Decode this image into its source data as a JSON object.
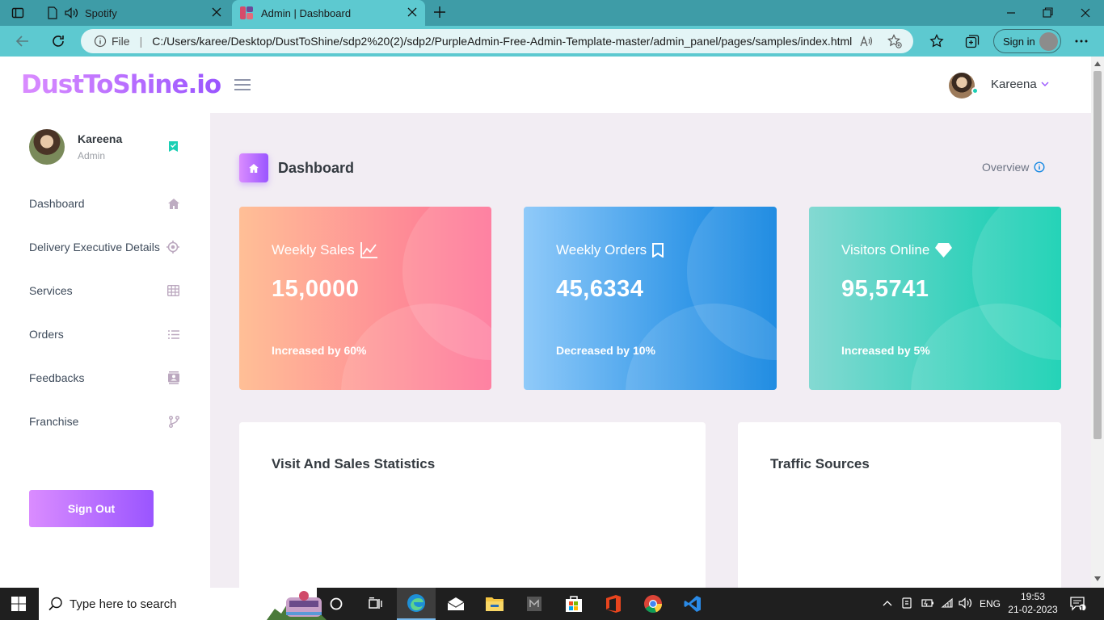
{
  "browser": {
    "tabs": [
      {
        "title": "Spotify"
      },
      {
        "title": "Admin | Dashboard"
      }
    ],
    "address": {
      "scheme_label": "File",
      "url": "C:/Users/karee/Desktop/DustToShine/sdp2%20(2)/sdp2/PurpleAdmin-Free-Admin-Template-master/admin_panel/pages/samples/index.html"
    },
    "signin_label": "Sign in"
  },
  "app": {
    "logo": "DustToShine.io",
    "user_menu_name": "Kareena"
  },
  "sidebar": {
    "profile": {
      "name": "Kareena",
      "role": "Admin"
    },
    "items": [
      {
        "label": "Dashboard",
        "icon": "home-icon"
      },
      {
        "label": "Delivery Executive Details",
        "icon": "crosshairs-icon"
      },
      {
        "label": "Services",
        "icon": "table-icon"
      },
      {
        "label": "Orders",
        "icon": "list-icon"
      },
      {
        "label": "Feedbacks",
        "icon": "contacts-icon"
      },
      {
        "label": "Franchise",
        "icon": "branch-icon"
      }
    ],
    "signout_label": "Sign Out"
  },
  "header": {
    "title": "Dashboard",
    "overview_label": "Overview"
  },
  "cards": [
    {
      "label": "Weekly Sales",
      "value": "15,0000",
      "footer": "Increased by 60%",
      "icon": "chart-line-icon"
    },
    {
      "label": "Weekly Orders",
      "value": "45,6334",
      "footer": "Decreased by 10%",
      "icon": "bookmark-icon"
    },
    {
      "label": "Visitors Online",
      "value": "95,5741",
      "footer": "Increased by 5%",
      "icon": "diamond-icon"
    }
  ],
  "panels": {
    "stats_title": "Visit And Sales Statistics",
    "traffic_title": "Traffic Sources"
  },
  "taskbar": {
    "search_placeholder": "Type here to search",
    "language": "ENG",
    "time": "19:53",
    "date": "21-02-2023",
    "notification_count": "1"
  },
  "colors": {
    "primary_gradient": [
      "#da8cff",
      "#9a55ff"
    ],
    "sales_gradient": [
      "#ffbf96",
      "#fe7096"
    ],
    "orders_gradient": [
      "#90caf9",
      "#047edf"
    ],
    "visitors_gradient": [
      "#84d9d2",
      "#07cdae"
    ],
    "tab_active": "#5dc9d0",
    "tabbar": "#3e9ca7"
  }
}
